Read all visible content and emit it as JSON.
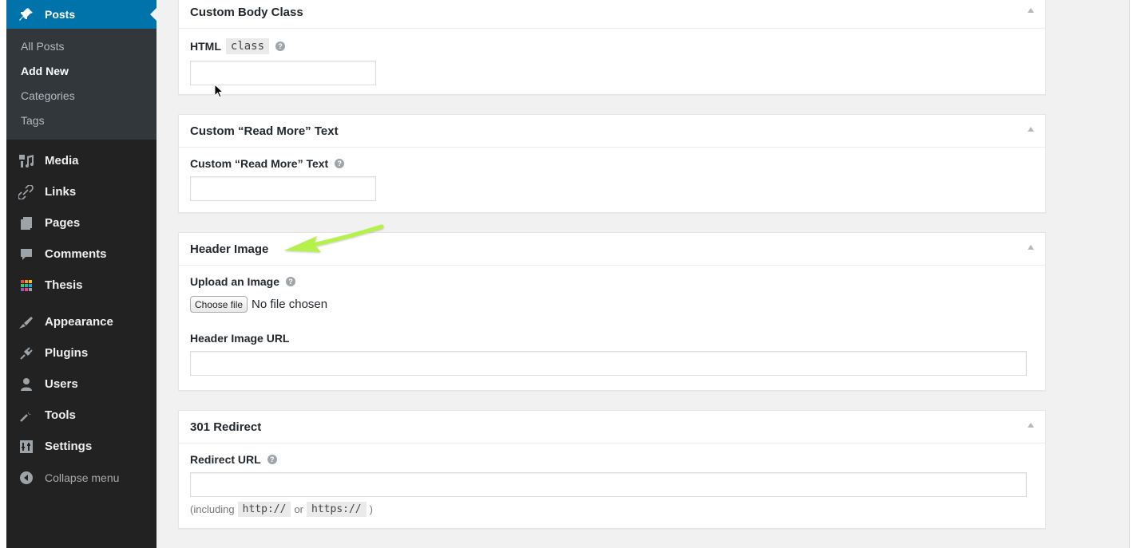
{
  "sidebar": {
    "active": "Posts",
    "submenu": [
      "All Posts",
      "Add New",
      "Categories",
      "Tags"
    ],
    "current_sub": "Add New",
    "items": [
      {
        "label": "Media",
        "icon": "media-icon"
      },
      {
        "label": "Links",
        "icon": "links-icon"
      },
      {
        "label": "Pages",
        "icon": "pages-icon"
      },
      {
        "label": "Comments",
        "icon": "comments-icon"
      },
      {
        "label": "Thesis",
        "icon": "thesis-icon"
      },
      {
        "label": "Appearance",
        "icon": "appearance-icon"
      },
      {
        "label": "Plugins",
        "icon": "plugins-icon"
      },
      {
        "label": "Users",
        "icon": "users-icon"
      },
      {
        "label": "Tools",
        "icon": "tools-icon"
      },
      {
        "label": "Settings",
        "icon": "settings-icon"
      }
    ],
    "collapse": "Collapse menu"
  },
  "boxes": {
    "body_class": {
      "title": "Custom Body Class",
      "label": "HTML",
      "code": "class",
      "value": ""
    },
    "read_more": {
      "title": "Custom “Read More” Text",
      "label": "Custom “Read More” Text",
      "value": ""
    },
    "header_image": {
      "title": "Header Image",
      "upload_label": "Upload an Image",
      "choose_button": "Choose file",
      "no_file": "No file chosen",
      "url_label": "Header Image URL",
      "url_value": ""
    },
    "redirect": {
      "title": "301 Redirect",
      "label": "Redirect URL",
      "value": "",
      "note_prefix": "(including",
      "note_code1": "http://",
      "note_or": "or",
      "note_code2": "https://",
      "note_suffix": ")"
    }
  },
  "colors": {
    "sidebar_bg": "#222222",
    "active_bg": "#0073aa",
    "submenu_bg": "#32373c",
    "annotation_arrow": "#b5f24a"
  }
}
